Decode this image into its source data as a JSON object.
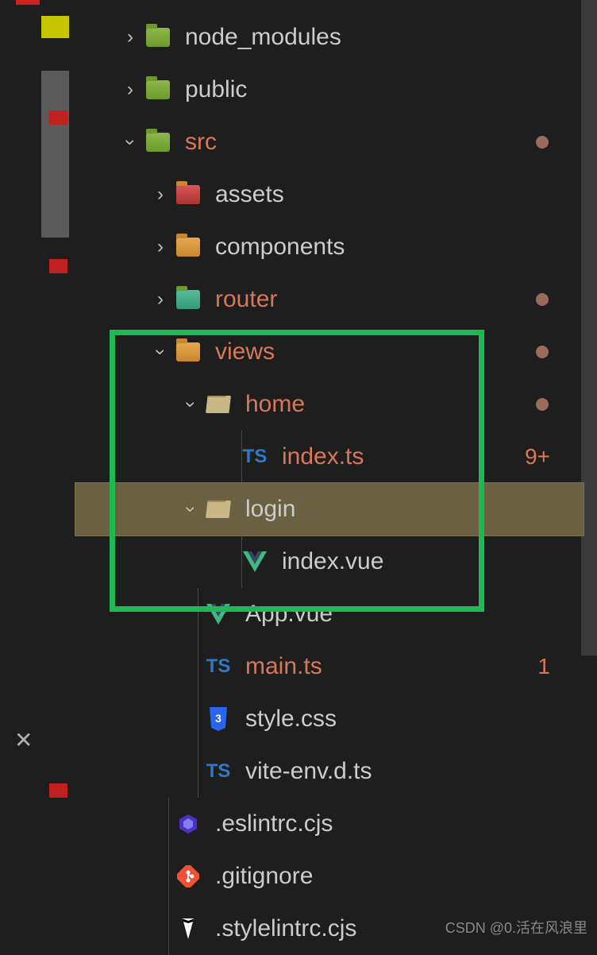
{
  "tree": {
    "node_modules": "node_modules",
    "public": "public",
    "src": "src",
    "assets": "assets",
    "components": "components",
    "router": "router",
    "views": "views",
    "home": "home",
    "home_index": "index.ts",
    "home_index_badge": "9+",
    "login": "login",
    "login_index": "index.vue",
    "app_vue": "App.vue",
    "main_ts": "main.ts",
    "main_ts_badge": "1",
    "style_css": "style.css",
    "vite_env": "vite-env.d.ts",
    "eslintrc": ".eslintrc.cjs",
    "gitignore": ".gitignore",
    "stylelintrc": ".stylelintrc.cjs"
  },
  "watermark": "CSDN @0.活在风浪里"
}
